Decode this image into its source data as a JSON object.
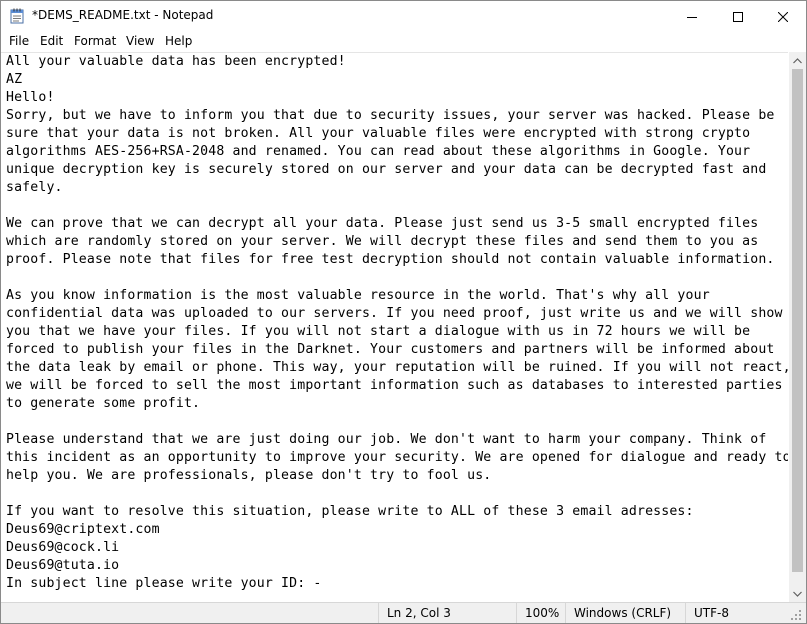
{
  "window": {
    "title": "*DEMS_README.txt - Notepad",
    "app_icon": "notepad-icon",
    "buttons": [
      "minimize-icon",
      "maximize-icon",
      "close-icon"
    ]
  },
  "menu": {
    "file": "File",
    "edit": "Edit",
    "format": "Format",
    "view": "View",
    "help": "Help"
  },
  "document": {
    "lines": [
      "All your valuable data has been encrypted!",
      "AZ",
      "Hello!",
      "Sorry, but we have to inform you that due to security issues, your server was hacked. Please be",
      "sure that your data is not broken. All your valuable files were encrypted with strong crypto",
      "algorithms AES-256+RSA-2048 and renamed. You can read about these algorithms in Google. Your",
      "unique decryption key is securely stored on our server and your data can be decrypted fast and",
      "safely.",
      "",
      "We can prove that we can decrypt all your data. Please just send us 3-5 small encrypted files",
      "which are randomly stored on your server. We will decrypt these files and send them to you as",
      "proof. Please note that files for free test decryption should not contain valuable information.",
      "",
      "As you know information is the most valuable resource in the world. That's why all your",
      "confidential data was uploaded to our servers. If you need proof, just write us and we will show",
      "you that we have your files. If you will not start a dialogue with us in 72 hours we will be",
      "forced to publish your files in the Darknet. Your customers and partners will be informed about",
      "the data leak by email or phone. This way, your reputation will be ruined. If you will not react,",
      "we will be forced to sell the most important information such as databases to interested parties",
      "to generate some profit.",
      "",
      "Please understand that we are just doing our job. We don't want to harm your company. Think of",
      "this incident as an opportunity to improve your security. We are opened for dialogue and ready to",
      "help you. We are professionals, please don't try to fool us.",
      "",
      "If you want to resolve this situation, please write to ALL of these 3 email adresses:",
      "Deus69@criptext.com",
      "Deus69@cock.li",
      "Deus69@tuta.io",
      "In subject line please write your ID: -"
    ]
  },
  "status": {
    "position": "Ln 2, Col 3",
    "zoom": "100%",
    "line_ending": "Windows (CRLF)",
    "encoding": "UTF-8"
  }
}
